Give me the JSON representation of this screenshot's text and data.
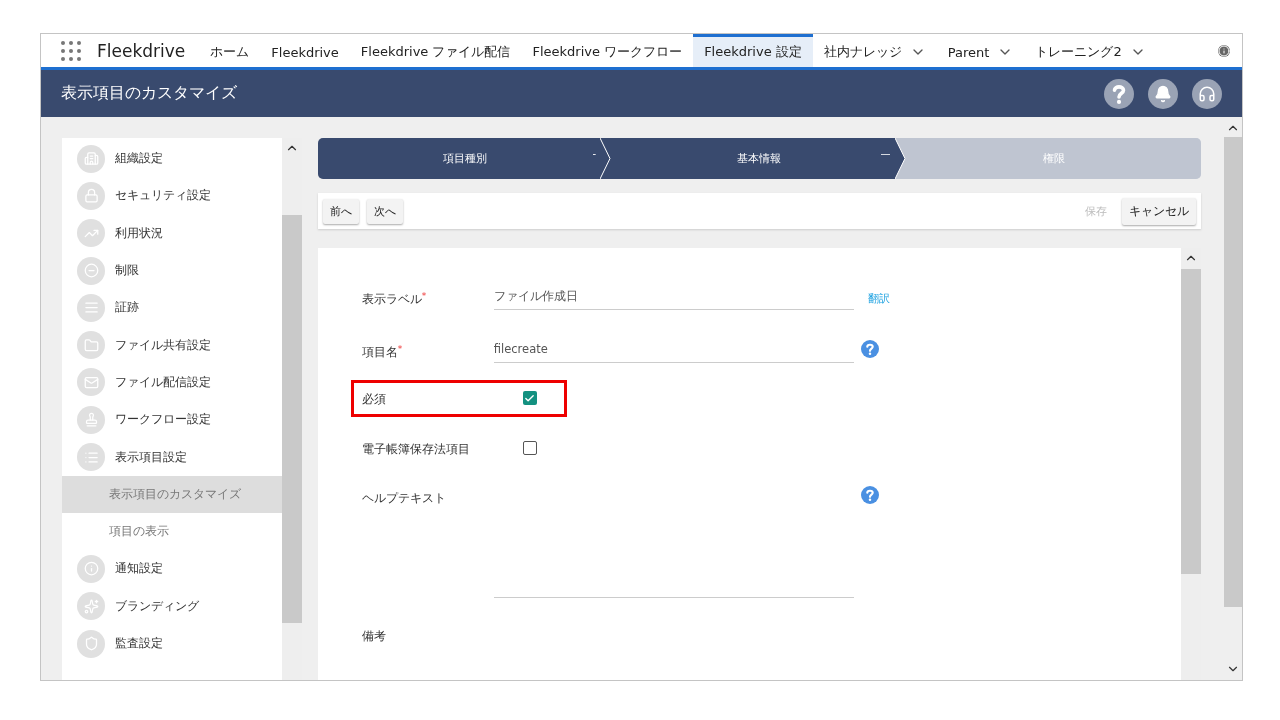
{
  "app": {
    "name": "Fleekdrive"
  },
  "nav_tabs": [
    {
      "label": "ホーム",
      "selected": false,
      "dropdown": false
    },
    {
      "label": "Fleekdrive",
      "selected": false,
      "dropdown": false
    },
    {
      "label": "Fleekdrive ファイル配信",
      "selected": false,
      "dropdown": false
    },
    {
      "label": "Fleekdrive ワークフロー",
      "selected": false,
      "dropdown": false
    },
    {
      "label": "Fleekdrive 設定",
      "selected": true,
      "dropdown": false
    },
    {
      "label": "社内ナレッジ",
      "selected": false,
      "dropdown": true
    },
    {
      "label": "Parent",
      "selected": false,
      "dropdown": true
    },
    {
      "label": "トレーニング2",
      "selected": false,
      "dropdown": true
    }
  ],
  "header": {
    "title": "表示項目のカスタマイズ"
  },
  "sidebar": {
    "items": [
      {
        "label": "組織設定",
        "selected": false
      },
      {
        "label": "セキュリティ設定",
        "selected": false
      },
      {
        "label": "利用状況",
        "selected": false
      },
      {
        "label": "制限",
        "selected": false
      },
      {
        "label": "証跡",
        "selected": false
      },
      {
        "label": "ファイル共有設定",
        "selected": false
      },
      {
        "label": "ファイル配信設定",
        "selected": false
      },
      {
        "label": "ワークフロー設定",
        "selected": false
      },
      {
        "label": "表示項目設定",
        "selected": false,
        "children": [
          {
            "label": "表示項目のカスタマイズ",
            "selected": true
          },
          {
            "label": "項目の表示",
            "selected": false
          }
        ]
      },
      {
        "label": "通知設定",
        "selected": false
      },
      {
        "label": "ブランディング",
        "selected": false
      },
      {
        "label": "監査設定",
        "selected": false
      }
    ]
  },
  "steps": [
    {
      "label": "項目種別",
      "active": true,
      "marker": "-"
    },
    {
      "label": "基本情報",
      "active": true,
      "marker": "—"
    },
    {
      "label": "権限",
      "active": false
    }
  ],
  "toolbar": {
    "left": [
      {
        "label": "前へ",
        "disabled": false
      },
      {
        "label": "次へ",
        "disabled": false
      }
    ],
    "right": [
      {
        "label": "保存",
        "disabled": true
      },
      {
        "label": "キャンセル",
        "disabled": false
      }
    ]
  },
  "form": {
    "fields": [
      {
        "kind": "text",
        "label": "表示ラベル",
        "required_mark": "*",
        "value": "ファイル作成日",
        "link": "翻訳",
        "highlighted": false
      },
      {
        "kind": "text",
        "label": "項目名",
        "required_mark": "*",
        "value": "filecreate",
        "help": true,
        "highlighted": false
      },
      {
        "kind": "checkbox",
        "label": "必須",
        "checked": true,
        "highlighted": true
      },
      {
        "kind": "checkbox",
        "label": "電子帳簿保存法項目",
        "checked": false,
        "highlighted": false
      },
      {
        "kind": "textarea",
        "label": "ヘルプテキスト",
        "help": true,
        "highlighted": false
      },
      {
        "kind": "label",
        "label": "備考",
        "highlighted": false
      }
    ]
  }
}
